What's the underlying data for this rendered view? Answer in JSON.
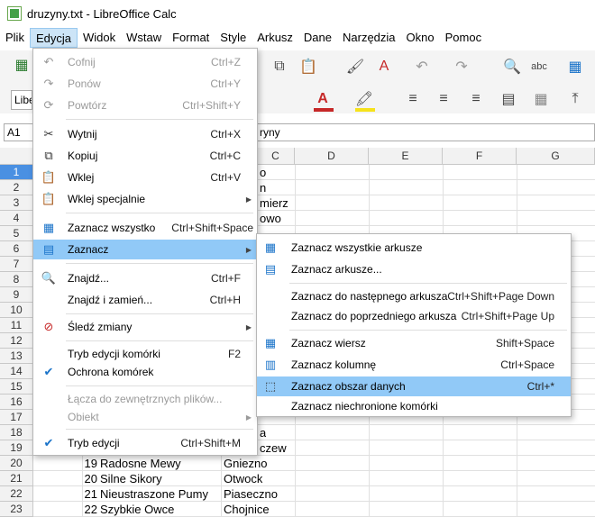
{
  "window": {
    "title": "druzyny.txt - LibreOffice Calc"
  },
  "menubar": [
    "Plik",
    "Edycja",
    "Widok",
    "Wstaw",
    "Format",
    "Style",
    "Arkusz",
    "Dane",
    "Narzędzia",
    "Okno",
    "Pomoc"
  ],
  "namebox": "A1",
  "fontbox": "Libe",
  "formula_visible_text": "ryny",
  "columns": [
    "C",
    "D",
    "E",
    "F",
    "G"
  ],
  "rows": [
    "1",
    "2",
    "3",
    "4",
    "5",
    "6",
    "7",
    "8",
    "9",
    "10",
    "11",
    "12",
    "13",
    "14",
    "15",
    "16",
    "17",
    "18",
    "19",
    "20",
    "21",
    "22",
    "23"
  ],
  "visible_cells": {
    "c1": "o",
    "c2": "n",
    "c3": "mierz",
    "c4": "owo",
    "c18": "a",
    "c19": "czew",
    "r20": {
      "a": "19",
      "b": "Radosne Mewy",
      "c": "Gniezno"
    },
    "r21": {
      "a": "20",
      "b": "Silne Sikory",
      "c": "Otwock"
    },
    "r22": {
      "a": "21",
      "b": "Nieustraszone Pumy",
      "c": "Piaseczno"
    },
    "r23": {
      "a": "22",
      "b": "Szybkie Owce",
      "c": "Chojnice"
    }
  },
  "edit_menu": {
    "items": [
      {
        "label": "Cofnij",
        "shortcut": "Ctrl+Z",
        "icon": "undo-icon",
        "disabled": true
      },
      {
        "label": "Ponów",
        "shortcut": "Ctrl+Y",
        "icon": "redo-icon",
        "disabled": true
      },
      {
        "label": "Powtórz",
        "shortcut": "Ctrl+Shift+Y",
        "icon": "repeat-icon",
        "disabled": true
      },
      {
        "label": "Wytnij",
        "shortcut": "Ctrl+X",
        "icon": "cut-icon"
      },
      {
        "label": "Kopiuj",
        "shortcut": "Ctrl+C",
        "icon": "copy-icon"
      },
      {
        "label": "Wklej",
        "shortcut": "Ctrl+V",
        "icon": "paste-icon"
      },
      {
        "label": "Wklej specjalnie",
        "shortcut": "",
        "icon": "paste-special-icon",
        "submenu": true
      },
      {
        "label": "Zaznacz wszystko",
        "shortcut": "Ctrl+Shift+Space",
        "icon": "select-all-icon"
      },
      {
        "label": "Zaznacz",
        "shortcut": "",
        "icon": "select-icon",
        "submenu": true,
        "highlighted": true
      },
      {
        "label": "Znajdź...",
        "shortcut": "Ctrl+F",
        "icon": "find-icon"
      },
      {
        "label": "Znajdź i zamień...",
        "shortcut": "Ctrl+H",
        "icon": ""
      },
      {
        "label": "Śledź zmiany",
        "shortcut": "",
        "icon": "track-changes-icon",
        "submenu": true
      },
      {
        "label": "Tryb edycji komórki",
        "shortcut": "F2",
        "icon": ""
      },
      {
        "label": "Ochrona komórek",
        "shortcut": "",
        "icon": "check-icon"
      },
      {
        "label": "Łącza do zewnętrznych plików...",
        "shortcut": "",
        "icon": "",
        "disabled": true
      },
      {
        "label": "Obiekt",
        "shortcut": "",
        "icon": "",
        "submenu": true,
        "disabled": true
      },
      {
        "label": "Tryb edycji",
        "shortcut": "Ctrl+Shift+M",
        "icon": "check-icon"
      }
    ]
  },
  "select_submenu": {
    "items": [
      {
        "label": "Zaznacz wszystkie arkusze",
        "shortcut": "",
        "icon": "select-all-sheets-icon"
      },
      {
        "label": "Zaznacz arkusze...",
        "shortcut": "",
        "icon": "select-sheets-icon"
      },
      {
        "label": "Zaznacz do następnego arkusza",
        "shortcut": "Ctrl+Shift+Page Down",
        "icon": ""
      },
      {
        "label": "Zaznacz do poprzedniego arkusza",
        "shortcut": "Ctrl+Shift+Page Up",
        "icon": ""
      },
      {
        "label": "Zaznacz wiersz",
        "shortcut": "Shift+Space",
        "icon": "select-row-icon"
      },
      {
        "label": "Zaznacz kolumnę",
        "shortcut": "Ctrl+Space",
        "icon": "select-column-icon"
      },
      {
        "label": "Zaznacz obszar danych",
        "shortcut": "Ctrl+*",
        "icon": "select-data-area-icon",
        "highlighted": true
      },
      {
        "label": "Zaznacz niechronione komórki",
        "shortcut": "",
        "icon": ""
      }
    ]
  },
  "colors": {
    "menu_highlight": "#91c9f7",
    "row_header_selected": "#4a90e2",
    "icon_blue": "#1a73c9"
  }
}
